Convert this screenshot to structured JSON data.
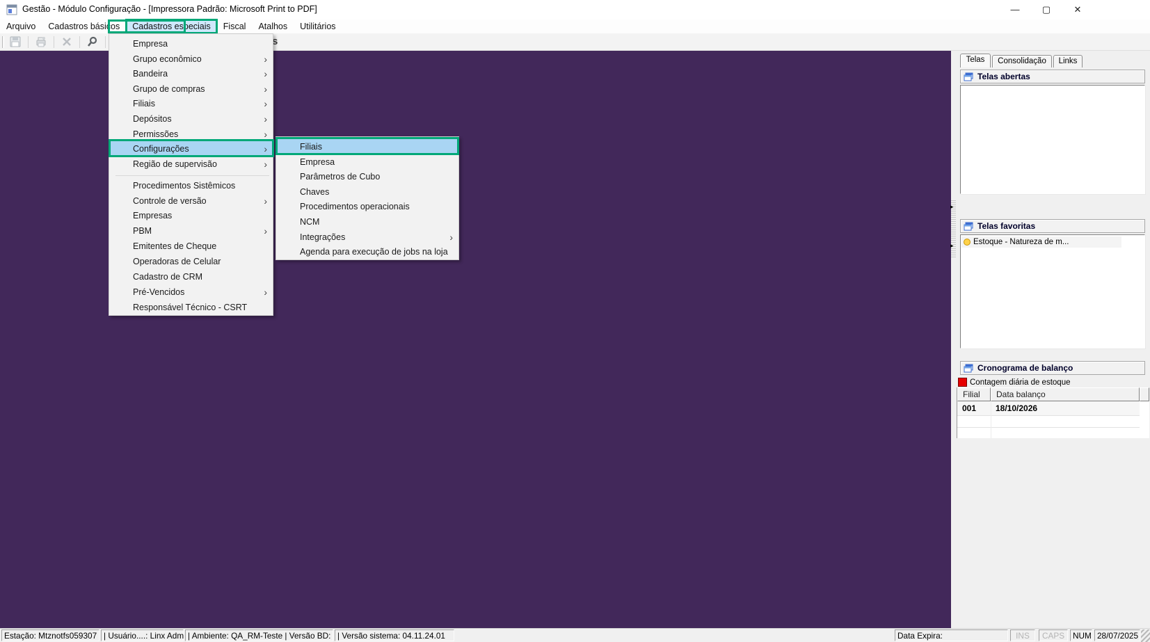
{
  "window": {
    "title": "Gestão  - Módulo Configuração - [Impressora Padrão: Microsoft Print to PDF]",
    "controls": {
      "minimize": "—",
      "maximize": "▢",
      "close": "✕"
    }
  },
  "menubar": {
    "items": [
      {
        "label": "Arquivo"
      },
      {
        "label": "Cadastros básicos"
      },
      {
        "label": "Cadastros especiais",
        "highlighted": true
      },
      {
        "label": "Fiscal"
      },
      {
        "label": "Atalhos"
      },
      {
        "label": "Utilitários"
      }
    ]
  },
  "toolbar": {
    "fragment": "s"
  },
  "menus": {
    "submenu_arrow": "›",
    "cadastros_especiais": {
      "items": [
        {
          "label": "Empresa"
        },
        {
          "label": "Grupo econômico",
          "arrow": true
        },
        {
          "label": "Bandeira",
          "arrow": true
        },
        {
          "label": "Grupo de compras",
          "arrow": true
        },
        {
          "label": "Filiais",
          "arrow": true
        },
        {
          "label": "Depósitos",
          "arrow": true
        },
        {
          "label": "Permissões",
          "arrow": true
        },
        {
          "label": "Configurações",
          "arrow": true,
          "highlighted": true
        },
        {
          "label": "Região de supervisão",
          "arrow": true
        },
        {
          "label": "Procedimentos Sistêmicos"
        },
        {
          "label": "Controle de versão",
          "arrow": true
        },
        {
          "label": "Empresas"
        },
        {
          "label": "PBM",
          "arrow": true
        },
        {
          "label": "Emitentes de Cheque"
        },
        {
          "label": "Operadoras de Celular"
        },
        {
          "label": "Cadastro de CRM"
        },
        {
          "label": "Pré-Vencidos",
          "arrow": true
        },
        {
          "label": "Responsável Técnico - CSRT"
        }
      ]
    },
    "configuracoes": {
      "items": [
        {
          "label": "Filiais",
          "highlighted": true
        },
        {
          "label": "Empresa"
        },
        {
          "label": "Parâmetros de Cubo"
        },
        {
          "label": "Chaves"
        },
        {
          "label": "Procedimentos operacionais"
        },
        {
          "label": "NCM"
        },
        {
          "label": "Integrações",
          "arrow": true
        },
        {
          "label": "Agenda para execução de jobs na loja"
        }
      ]
    }
  },
  "right_panel": {
    "tabs": [
      {
        "label": "Telas",
        "active": true
      },
      {
        "label": "Consolidação"
      },
      {
        "label": "Links"
      }
    ],
    "telas_abertas": {
      "title": "Telas abertas"
    },
    "telas_favoritas": {
      "title": "Telas favoritas",
      "items": [
        {
          "label": "Estoque - Natureza de m..."
        }
      ]
    },
    "cronograma": {
      "title": "Cronograma de balanço",
      "legend": "Contagem diária de estoque",
      "table": {
        "headers": [
          "Filial",
          "Data balanço"
        ],
        "rows": [
          [
            "001",
            "18/10/2026"
          ]
        ]
      }
    }
  },
  "status_bar": {
    "segments": [
      "Estação: Mtznotfs059307",
      "| Usuário....: Linx Adm",
      "| Ambiente: QA_RM-Teste | Versão BD:",
      "| Versão sistema: 04.11.24.01"
    ],
    "data_expira": "Data Expira:",
    "ins": "INS",
    "caps": "CAPS",
    "num": "NUM",
    "date": "28/07/2025"
  },
  "colors": {
    "annotation_green": "#00a878",
    "highlight_blue": "#a9d5f3",
    "mdi_purple": "#42285a",
    "alert_red": "#e60000"
  }
}
